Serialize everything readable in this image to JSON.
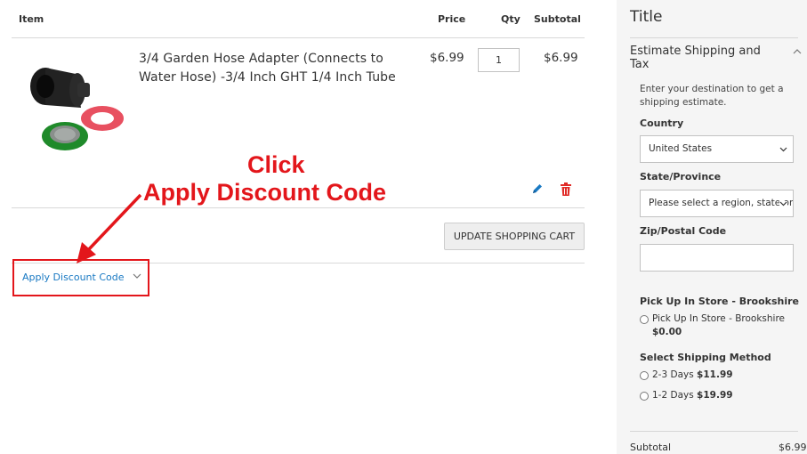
{
  "cart": {
    "headers": {
      "item": "Item",
      "price": "Price",
      "qty": "Qty",
      "subtotal": "Subtotal"
    },
    "items": [
      {
        "name": "3/4 Garden Hose Adapter (Connects to Water Hose) -3/4 Inch GHT 1/4 Inch Tube",
        "price": "$6.99",
        "qty": "1",
        "subtotal": "$6.99"
      }
    ],
    "update_label": "UPDATE SHOPPING CART",
    "discount_label": "Apply Discount Code"
  },
  "annotation": {
    "line1": "Click",
    "line2": "Apply Discount Code",
    "color": "#e3161b"
  },
  "summary": {
    "title": "Title",
    "estimate_title": "Estimate Shipping and Tax",
    "estimate_desc": "Enter your destination to get a shipping estimate.",
    "country_label": "Country",
    "country_value": "United States",
    "state_label": "State/Province",
    "state_value": "Please select a region, state or province.",
    "zip_label": "Zip/Postal Code",
    "zip_value": "",
    "pickup_heading": "Pick Up In Store - Brookshire",
    "pickup_option": "Pick Up In Store - Brookshire",
    "pickup_price": "$0.00",
    "method_heading": "Select Shipping Method",
    "method_options": [
      {
        "label": "2-3 Days",
        "price": "$11.99"
      },
      {
        "label": "1-2 Days",
        "price": "$19.99"
      }
    ],
    "subtotal_label": "Subtotal",
    "subtotal_value": "$6.99"
  },
  "colors": {
    "link": "#1979c3",
    "annotation_red": "#e3161b",
    "delete_red": "#e02b27",
    "sidebar_bg": "#f5f5f5"
  },
  "icons": [
    "edit-icon",
    "trash-icon",
    "chevron-down-icon",
    "chevron-up-icon",
    "arrow-icon"
  ]
}
